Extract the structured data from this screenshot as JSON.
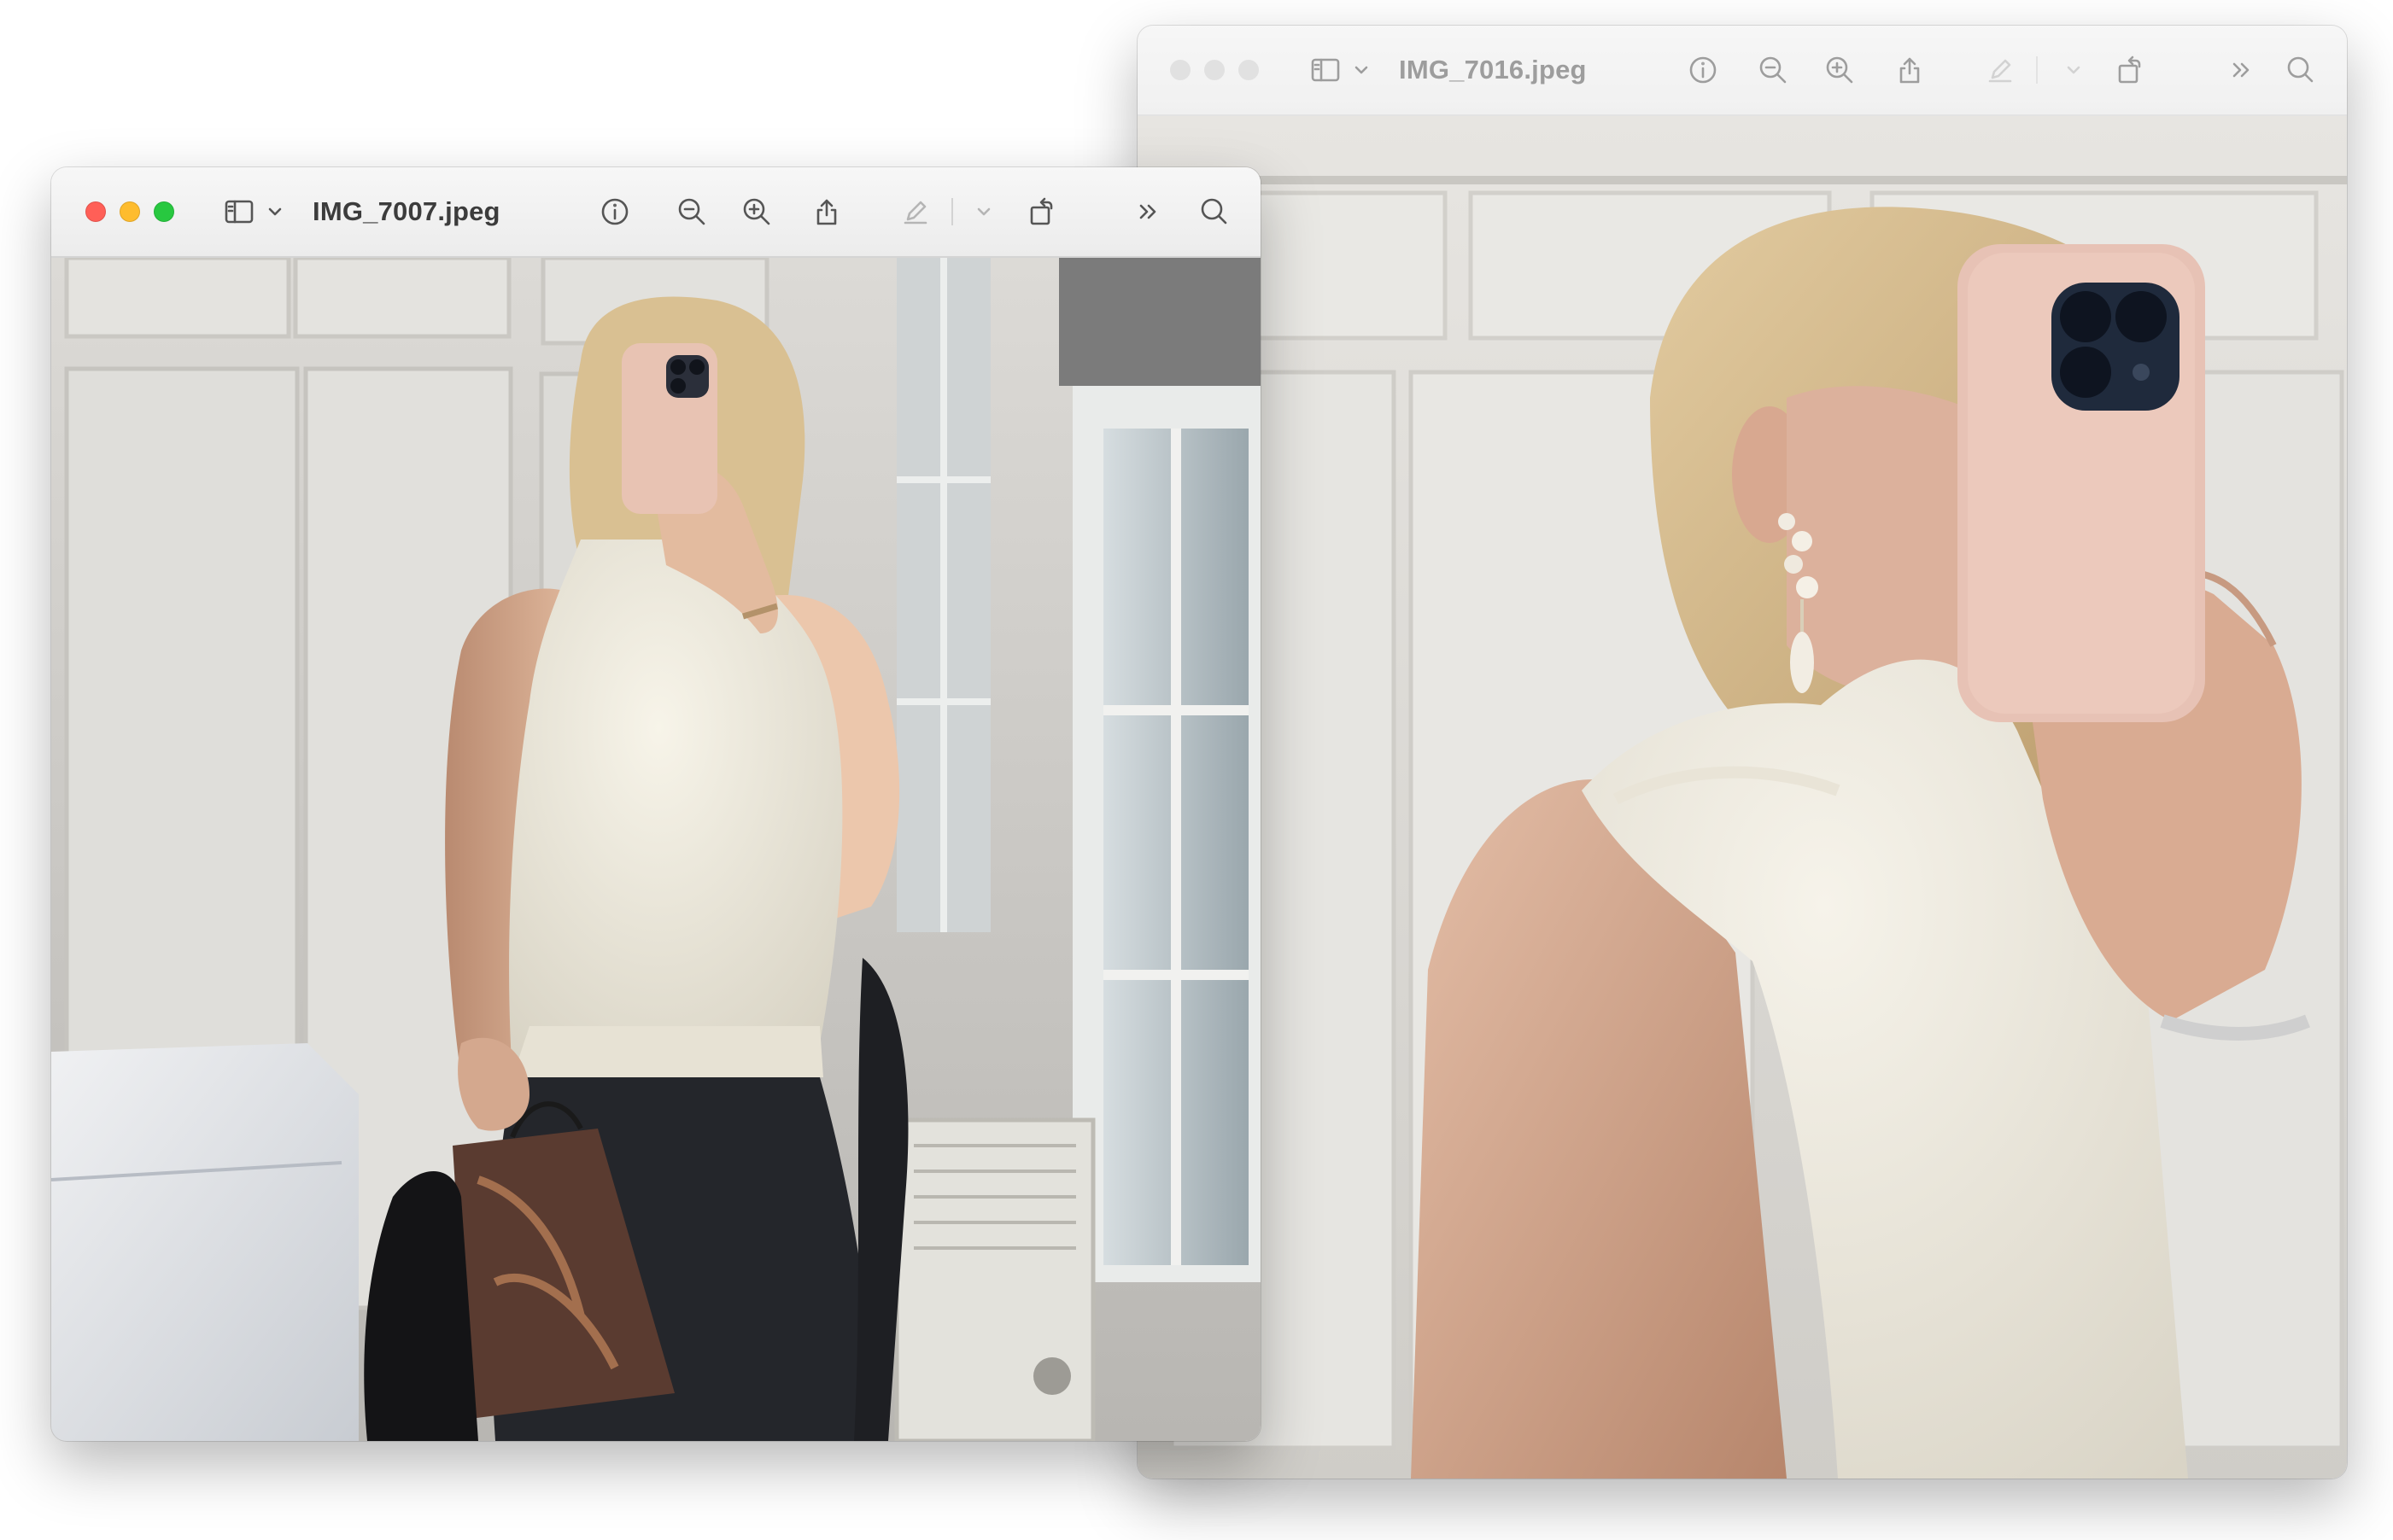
{
  "windows": [
    {
      "id": "front",
      "title": "IMG_7007.jpeg",
      "active": true,
      "photo_alt": "mirror selfie in cream sleeveless knit, bedroom with white wardrobes"
    },
    {
      "id": "back",
      "title": "IMG_7016.jpeg",
      "active": false,
      "photo_alt": "close-up mirror selfie with pearl earring and pink phone case"
    }
  ],
  "toolbar_icons": [
    "sidebar-toggle-icon",
    "chevron-down-icon",
    "info-icon",
    "zoom-out-icon",
    "zoom-in-icon",
    "share-icon",
    "markup-pen-icon",
    "chevron-down-icon",
    "rotate-icon",
    "more-tools-icon",
    "search-icon"
  ],
  "colors": {
    "traffic_red": "#ff5f57",
    "traffic_yellow": "#febc2e",
    "traffic_green": "#28c840",
    "toolbar_bg": "#f1f1f1",
    "icon": "#555555"
  }
}
